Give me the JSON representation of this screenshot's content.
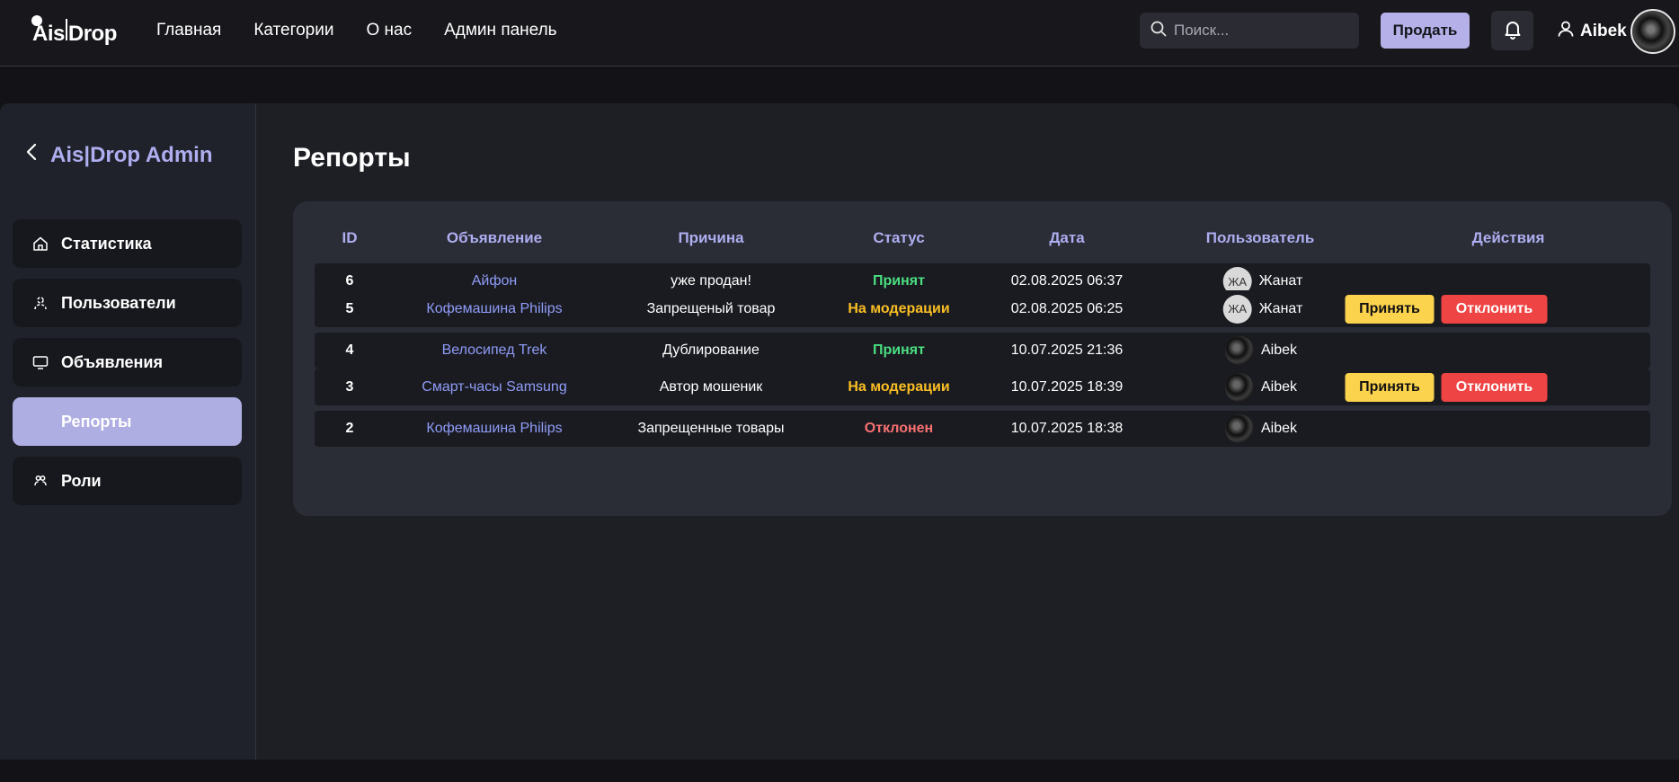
{
  "header": {
    "logo": "Ais|Drop",
    "nav": [
      "Главная",
      "Категории",
      "О нас",
      "Админ панель"
    ],
    "search_placeholder": "Поиск...",
    "sell_label": "Продать",
    "username": "Aibek"
  },
  "sidebar": {
    "title": "Ais|Drop Admin",
    "items": [
      {
        "label": "Статистика",
        "icon": "home-icon"
      },
      {
        "label": "Пользователи",
        "icon": "users-icon"
      },
      {
        "label": "Объявления",
        "icon": "monitor-icon"
      },
      {
        "label": "Репорты",
        "icon": "",
        "active": true
      },
      {
        "label": "Роли",
        "icon": "roles-icon"
      }
    ]
  },
  "main": {
    "title": "Репорты",
    "columns": [
      "ID",
      "Объявление",
      "Причина",
      "Статус",
      "Дата",
      "Пользователь",
      "Действия"
    ],
    "accept_label": "Принять",
    "reject_label": "Отклонить",
    "rows": [
      {
        "id": "6",
        "ad": "Айфон",
        "reason": "уже продан!",
        "status": "Принят",
        "status_type": "accepted",
        "date": "02.08.2025 06:37",
        "avatar_initials": "ЖА",
        "user": "Жанат",
        "has_actions": false
      },
      {
        "id": "5",
        "ad": "Кофемашина Philips",
        "reason": "Запрещеный товар",
        "status": "На модерации",
        "status_type": "moderation",
        "date": "02.08.2025 06:25",
        "avatar_initials": "ЖА",
        "user": "Жанат",
        "has_actions": true
      },
      {
        "id": "4",
        "ad": "Велосипед Trek",
        "reason": "Дублирование",
        "status": "Принят",
        "status_type": "accepted",
        "date": "10.07.2025 21:36",
        "avatar_initials": "",
        "user": "Aibek",
        "has_actions": false
      },
      {
        "id": "3",
        "ad": "Смарт-часы Samsung",
        "reason": "Автор мошеник",
        "status": "На модерации",
        "status_type": "moderation",
        "date": "10.07.2025 18:39",
        "avatar_initials": "",
        "user": "Aibek",
        "has_actions": true
      },
      {
        "id": "2",
        "ad": "Кофемашина Philips",
        "reason": "Запрещенные товары",
        "status": "Отклонен",
        "status_type": "rejected",
        "date": "10.07.2025 18:38",
        "avatar_initials": "",
        "user": "Aibek",
        "has_actions": false
      }
    ]
  },
  "colors": {
    "accent": "#b5b1e8",
    "accepted": "#4ade80",
    "moderation": "#fbbf24",
    "rejected": "#f87171",
    "accept_button": "#fcd34d",
    "reject_button": "#ef4444"
  }
}
